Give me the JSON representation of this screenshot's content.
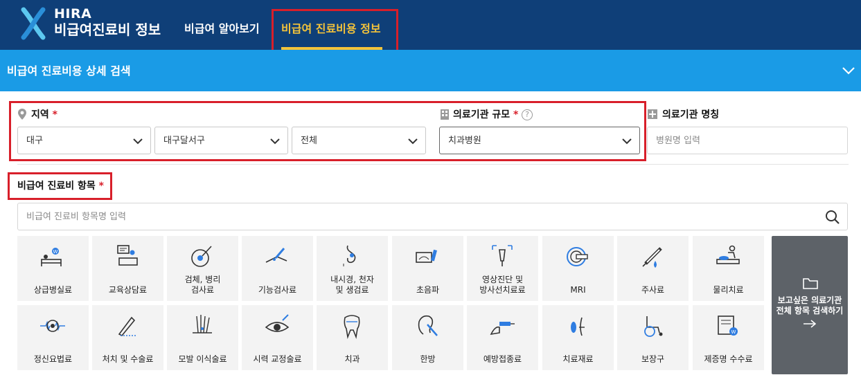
{
  "header": {
    "logo_line1": "HIRA",
    "logo_line2": "비급여진료비 정보",
    "nav": [
      {
        "label": "비급여 알아보기",
        "active": false
      },
      {
        "label": "비급여 진료비용 정보",
        "active": true
      }
    ]
  },
  "search_bar": {
    "title": "비급여 진료비용 상세 검색",
    "toggle_icon": "chevron-down-icon"
  },
  "region": {
    "label": "지역",
    "required_mark": "*",
    "icon": "location-pin-icon",
    "selects": [
      "대구",
      "대구달서구",
      "전체"
    ]
  },
  "facility_size": {
    "label": "의료기관 규모",
    "required_mark": "*",
    "icon": "building-icon",
    "help_icon": "question-icon",
    "help_glyph": "?",
    "selected": "치과병원"
  },
  "facility_name": {
    "label": "의료기관 명칭",
    "icon": "hospital-icon",
    "placeholder": "병원명 입력"
  },
  "items": {
    "label": "비급여 진료비 항목",
    "required_mark": "*",
    "placeholder": "비급여 진료비 항목명 입력",
    "search_icon": "search-icon",
    "categories": [
      {
        "label": "상급병실료",
        "icon": "hospital-bed-icon"
      },
      {
        "label": "교육상담료",
        "icon": "counseling-icon"
      },
      {
        "label": "검체, 병리\n검사료",
        "icon": "microscope-icon"
      },
      {
        "label": "기능검사료",
        "icon": "function-test-icon"
      },
      {
        "label": "내시경, 천자\n및 생검료",
        "icon": "endoscope-icon"
      },
      {
        "label": "초음파",
        "icon": "ultrasound-icon"
      },
      {
        "label": "영상진단 및\n방사선치료료",
        "icon": "radiology-icon"
      },
      {
        "label": "MRI",
        "icon": "mri-icon"
      },
      {
        "label": "주사료",
        "icon": "syringe-icon"
      },
      {
        "label": "물리치료",
        "icon": "physical-therapy-icon"
      },
      {
        "label": "정신요법료",
        "icon": "brain-wave-icon"
      },
      {
        "label": "처치 및 수술료",
        "icon": "scalpel-icon"
      },
      {
        "label": "모발 이식술료",
        "icon": "hair-transplant-icon"
      },
      {
        "label": "시력 교정술료",
        "icon": "eye-icon"
      },
      {
        "label": "치과",
        "icon": "tooth-icon"
      },
      {
        "label": "한방",
        "icon": "acupuncture-icon"
      },
      {
        "label": "예방접종료",
        "icon": "vaccine-icon"
      },
      {
        "label": "치료재료",
        "icon": "medical-material-icon"
      },
      {
        "label": "보장구",
        "icon": "wheelchair-icon"
      },
      {
        "label": "제증명 수수료",
        "icon": "certificate-icon"
      }
    ],
    "view_all": {
      "text": "보고싶은 의료기관\n전체 항목 검색하기",
      "icon": "folder-icon",
      "arrow": "→"
    }
  },
  "colors": {
    "header_bg": "#0f3f78",
    "accent_yellow": "#f4c33a",
    "search_bar_bg": "#1a9be6",
    "required_red": "#d81f2a",
    "highlight_red": "#d81f2a",
    "tile_bg": "#f3f3f3",
    "view_all_bg": "#5d6268"
  }
}
